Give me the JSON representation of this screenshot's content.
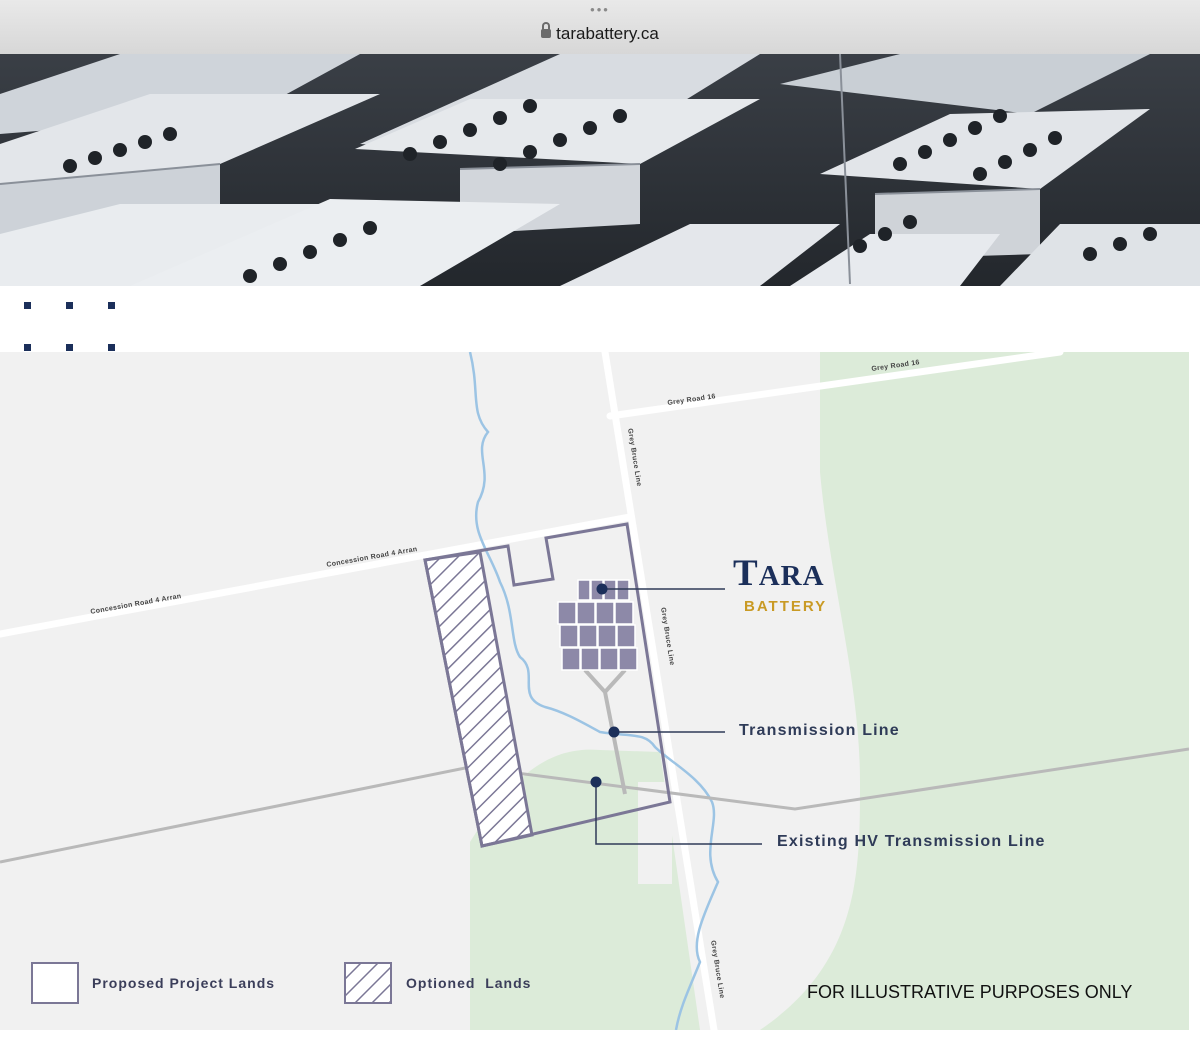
{
  "browser": {
    "dots": "•••",
    "url": "tarabattery.ca"
  },
  "hero": {
    "image": "battery-storage-containers-photo"
  },
  "map": {
    "roads": {
      "grey_road_16_a": "Grey Road 16",
      "grey_road_16_b": "Grey Road 16",
      "grey_bruce_line_a": "Grey Bruce Line",
      "grey_bruce_line_b": "Grey Bruce Line",
      "grey_bruce_line_c": "Grey Bruce Line",
      "concession_a": "Concession Road 4 Arran",
      "concession_b": "Concession Road 4 Arran"
    },
    "logo": {
      "tara_first": "T",
      "tara_rest": "ARA",
      "battery": "BATTERY"
    },
    "callouts": {
      "transmission": "Transmission Line",
      "existing_hv": "Existing HV Transmission Line"
    },
    "legend": {
      "proposed": "Proposed Project Lands",
      "optioned": "Optioned  Lands"
    },
    "disclaimer": "FOR ILLUSTRATIVE PURPOSES ONLY",
    "colors": {
      "boundary": "#7b7796",
      "battery_cells": "#8d89a8",
      "callout_dot": "#1b2f5a",
      "green_land": "#dcebd9",
      "river": "#9cc4e4",
      "hv_line": "#b9b9b9"
    }
  }
}
